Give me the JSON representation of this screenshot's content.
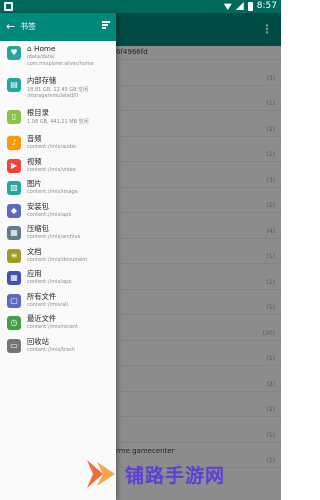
{
  "status_bar": {
    "time": "8:57"
  },
  "background": {
    "hash_text": "6f4966fd",
    "rows": [
      {
        "text": "",
        "count": "(3)"
      },
      {
        "text": "",
        "count": "(1)"
      },
      {
        "text": "",
        "count": "(1)"
      },
      {
        "text": "",
        "count": "(1)"
      },
      {
        "text": "",
        "count": "(3)"
      },
      {
        "text": "",
        "count": "(1)"
      },
      {
        "text": "",
        "count": "(4)"
      },
      {
        "text": "",
        "count": "(1)"
      },
      {
        "text": "",
        "count": "(1)"
      },
      {
        "text": "",
        "count": "(1)"
      },
      {
        "text": "",
        "count": "(20)"
      },
      {
        "text": "",
        "count": "(1)"
      },
      {
        "text": "",
        "count": "(2)"
      },
      {
        "text": "",
        "count": "(1)"
      },
      {
        "text": "",
        "count": "(1)"
      },
      {
        "text": "rme.gamecenter",
        "count": "(1)"
      }
    ]
  },
  "drawer": {
    "title": "书签",
    "items": [
      {
        "name": "⌂ Home",
        "sub": "/data/data/",
        "sub2": "com.mixplorer.silver/home",
        "color": "#26a69a",
        "icon": "♥"
      },
      {
        "name": "内部存储",
        "sub": "18.81 GB, 12.45 GB 空闲",
        "sub2": "/storage/emulated/0",
        "color": "#26a69a",
        "icon": "▤"
      },
      {
        "name": "根目录",
        "sub": "1.08 GB, 441.21 MB 空闲",
        "sub2": "",
        "color": "#8bc34a",
        "icon": "▯"
      },
      {
        "name": "音频",
        "sub": "content://mix/audio",
        "color": "#ff9800",
        "icon": "♪"
      },
      {
        "name": "视频",
        "sub": "content://mix/video",
        "color": "#f44336",
        "icon": "▶"
      },
      {
        "name": "图片",
        "sub": "content://mix/image",
        "color": "#26a69a",
        "icon": "▨"
      },
      {
        "name": "安装包",
        "sub": "content://mix/apk",
        "color": "#5c6bc0",
        "icon": "◆"
      },
      {
        "name": "压缩包",
        "sub": "content://mix/archive",
        "color": "#607d8b",
        "icon": "▦"
      },
      {
        "name": "文档",
        "sub": "content://mix/document",
        "color": "#9e9d24",
        "icon": "≡"
      },
      {
        "name": "应用",
        "sub": "content://mix/app",
        "color": "#3f51b5",
        "icon": "▦"
      },
      {
        "name": "所有文件",
        "sub": "content://mix/all",
        "color": "#5c6bc0",
        "icon": "▢"
      },
      {
        "name": "最近文件",
        "sub": "content://mix/recent",
        "color": "#43a047",
        "icon": "◷"
      },
      {
        "name": "回收站",
        "sub": "content://mix/trash",
        "color": "#757575",
        "icon": "▭"
      }
    ]
  },
  "watermark": {
    "text": "铺路手游网"
  }
}
